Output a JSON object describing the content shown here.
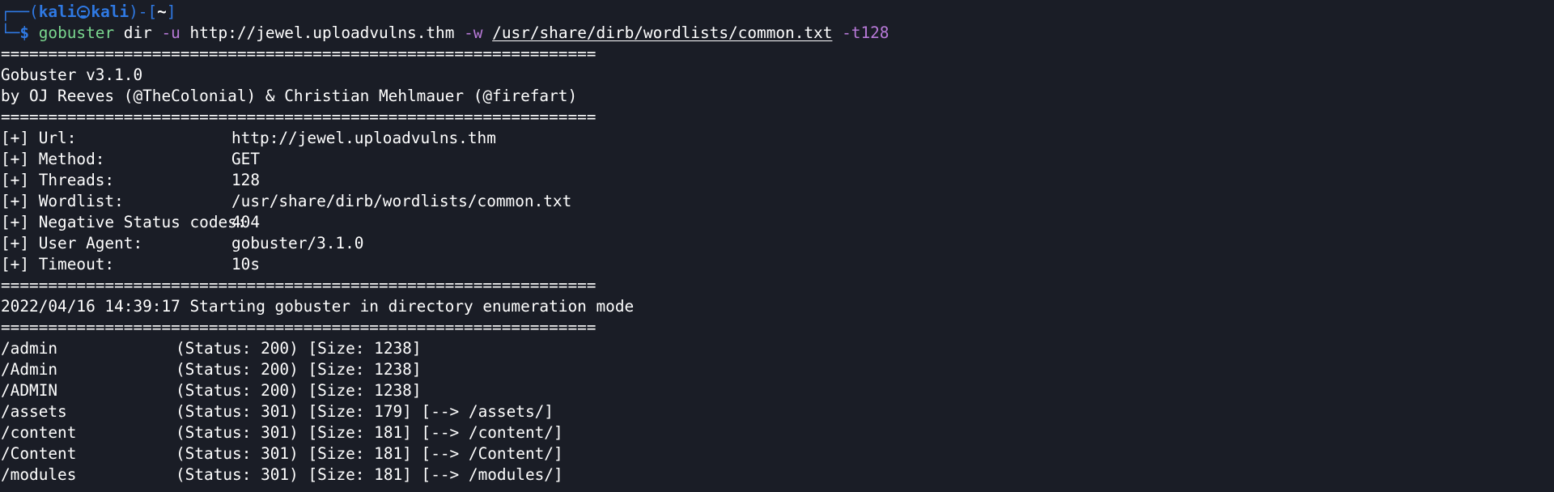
{
  "prompt": {
    "corner_top": "┌──",
    "open": "(",
    "user": "kali",
    "host": "kali",
    "close": ")-[",
    "dir": "~",
    "end": "]",
    "corner_bottom": "└─",
    "dollar": "$ "
  },
  "command": {
    "program": "gobuster",
    "arg1": " dir ",
    "flag_u": "-u",
    "url": " http://jewel.uploadvulns.thm ",
    "flag_w": "-w",
    "space": " ",
    "wordlist": "/usr/share/dirb/wordlists/common.txt",
    "space2": " ",
    "flag_t": "-t128"
  },
  "separator": "===============================================================",
  "banner": {
    "version": "Gobuster v3.1.0",
    "authors": "by OJ Reeves (@TheColonial) & Christian Mehlmauer (@firefart)"
  },
  "config": [
    {
      "key": "[+] Url:",
      "value": "http://jewel.uploadvulns.thm"
    },
    {
      "key": "[+] Method:",
      "value": "GET"
    },
    {
      "key": "[+] Threads:",
      "value": "128"
    },
    {
      "key": "[+] Wordlist:",
      "value": "/usr/share/dirb/wordlists/common.txt"
    },
    {
      "key": "[+] Negative Status codes:",
      "value": "404"
    },
    {
      "key": "[+] User Agent:",
      "value": "gobuster/3.1.0"
    },
    {
      "key": "[+] Timeout:",
      "value": "10s"
    }
  ],
  "start_line": "2022/04/16 14:39:17 Starting gobuster in directory enumeration mode",
  "results": [
    {
      "path": "/admin",
      "info": "(Status: 200) [Size: 1238]"
    },
    {
      "path": "/Admin",
      "info": "(Status: 200) [Size: 1238]"
    },
    {
      "path": "/ADMIN",
      "info": "(Status: 200) [Size: 1238]"
    },
    {
      "path": "/assets",
      "info": "(Status: 301) [Size: 179] [--> /assets/]"
    },
    {
      "path": "/content",
      "info": "(Status: 301) [Size: 181] [--> /content/]"
    },
    {
      "path": "/Content",
      "info": "(Status: 301) [Size: 181] [--> /Content/]"
    },
    {
      "path": "/modules",
      "info": "(Status: 301) [Size: 181] [--> /modules/]"
    }
  ],
  "colors": {
    "background": "#1a1d26",
    "prompt_blue": "#2f79e3",
    "command_green": "#7bd88f",
    "flag_purple": "#b97ad9",
    "text": "#ffffff"
  }
}
